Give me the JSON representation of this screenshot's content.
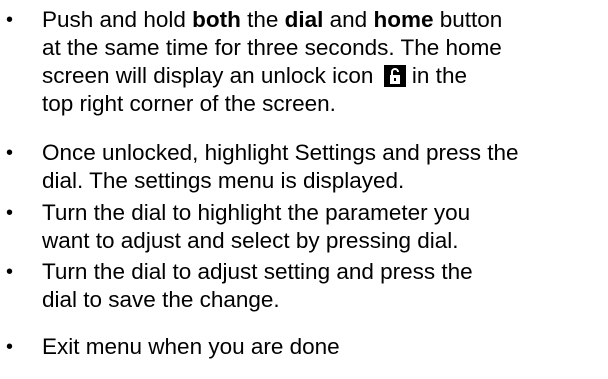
{
  "bullet_char": "•",
  "items": [
    {
      "lines": [
        {
          "t1": "Push and hold ",
          "b1": "both",
          "t2": " the ",
          "b2": "dial",
          "t3": " and ",
          "b3": "home",
          "t4": " button"
        },
        {
          "text": "at the same time for three seconds. The home"
        },
        {
          "before_icon": "screen will display an unlock icon ",
          "after_icon": "  in the"
        },
        {
          "text": "top right corner of the screen."
        }
      ],
      "icon": "unlock-icon"
    },
    {
      "lines": [
        {
          "text": "Once unlocked, highlight Settings and press the"
        },
        {
          "text": "dial.  The settings menu is displayed."
        }
      ]
    },
    {
      "lines": [
        {
          "text": "Turn the dial to highlight the parameter you"
        },
        {
          "text": "want to adjust and select by pressing dial."
        }
      ]
    },
    {
      "lines": [
        {
          "text": " Turn the dial to adjust setting and press  the"
        },
        {
          "text": "dial to save the change."
        }
      ]
    },
    {
      "lines": [
        {
          "text": " Exit menu when you are done"
        }
      ]
    }
  ]
}
